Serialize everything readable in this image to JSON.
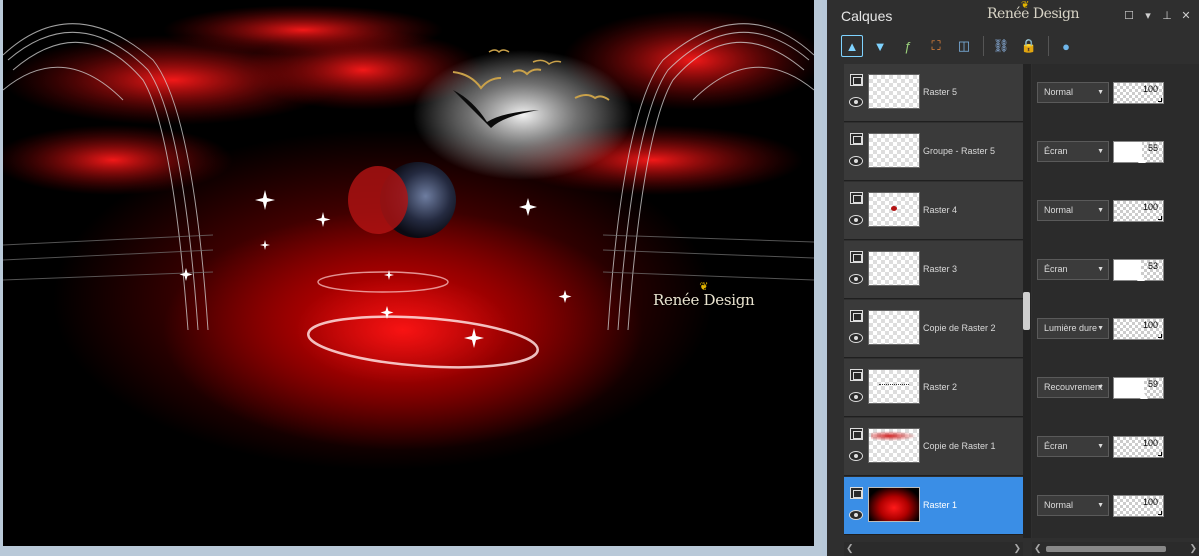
{
  "canvas": {
    "watermark": "Renée Design",
    "watermark_icon": "butterfly-icon"
  },
  "panel": {
    "title": "Calques",
    "logo": "Renée Design",
    "controls": [
      "maximize-icon",
      "dropdown-icon",
      "pin-icon",
      "close-icon"
    ],
    "toolbar": [
      {
        "icon": "move-up-icon",
        "color": "#7fd3ff"
      },
      {
        "icon": "move-down-icon",
        "color": "#7fd3ff"
      },
      {
        "icon": "visibility-toggle-icon",
        "color": "#9bd17c"
      },
      {
        "icon": "selection-icon",
        "color": "#f08a3a"
      },
      {
        "icon": "adjustment-icon",
        "color": "#7fb7e8"
      },
      {
        "icon": "link-icon",
        "color": "#8fb7e6"
      },
      {
        "icon": "lock-icon",
        "color": "#e6b84c"
      },
      {
        "icon": "properties-icon",
        "color": "#6fb6ea"
      }
    ],
    "layers": [
      {
        "name": "Raster 5",
        "blend": "Normal",
        "opacity": "100",
        "thumb": "empty"
      },
      {
        "name": "Groupe - Raster 5",
        "blend": "Écran",
        "opacity": "55",
        "thumb": "empty"
      },
      {
        "name": "Raster 4",
        "blend": "Normal",
        "opacity": "100",
        "thumb": "dot"
      },
      {
        "name": "Raster 3",
        "blend": "Écran",
        "opacity": "53",
        "thumb": "empty"
      },
      {
        "name": "Copie de Raster 2",
        "blend": "Lumière dure",
        "opacity": "100",
        "thumb": "empty"
      },
      {
        "name": "Raster 2",
        "blend": "Recouvrement",
        "opacity": "59",
        "thumb": "scribble"
      },
      {
        "name": "Copie de Raster 1",
        "blend": "Écran",
        "opacity": "100",
        "thumb": "redsmear"
      },
      {
        "name": "Raster 1",
        "blend": "Normal",
        "opacity": "100",
        "thumb": "dark",
        "selected": true
      }
    ]
  }
}
